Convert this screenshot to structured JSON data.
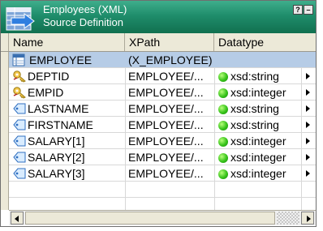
{
  "window": {
    "title_line1": "Employees (XML)",
    "title_line2": "Source Definition",
    "help_label": "?",
    "minimize_label": "–"
  },
  "columns": [
    "Name",
    "XPath",
    "Datatype"
  ],
  "group_row": {
    "name": "EMPLOYEE",
    "xpath": "(X_EMPLOYEE)",
    "icon": "table-icon"
  },
  "rows": [
    {
      "name": "DEPTID",
      "xpath": "EMPLOYEE/...",
      "datatype": "xsd:string",
      "icon": "key-icon"
    },
    {
      "name": "EMPID",
      "xpath": "EMPLOYEE/...",
      "datatype": "xsd:integer",
      "icon": "key-icon"
    },
    {
      "name": "LASTNAME",
      "xpath": "EMPLOYEE/...",
      "datatype": "xsd:string",
      "icon": "tag-icon"
    },
    {
      "name": "FIRSTNAME",
      "xpath": "EMPLOYEE/...",
      "datatype": "xsd:string",
      "icon": "tag-icon"
    },
    {
      "name": "SALARY[1]",
      "xpath": "EMPLOYEE/...",
      "datatype": "xsd:integer",
      "icon": "tag-icon"
    },
    {
      "name": "SALARY[2]",
      "xpath": "EMPLOYEE/...",
      "datatype": "xsd:integer",
      "icon": "tag-icon"
    },
    {
      "name": "SALARY[3]",
      "xpath": "EMPLOYEE/...",
      "datatype": "xsd:integer",
      "icon": "tag-icon"
    }
  ],
  "colors": {
    "title_bar": "#1f8d6b",
    "selection": "#b6cce6",
    "datatype_dot": "#37c31a"
  }
}
